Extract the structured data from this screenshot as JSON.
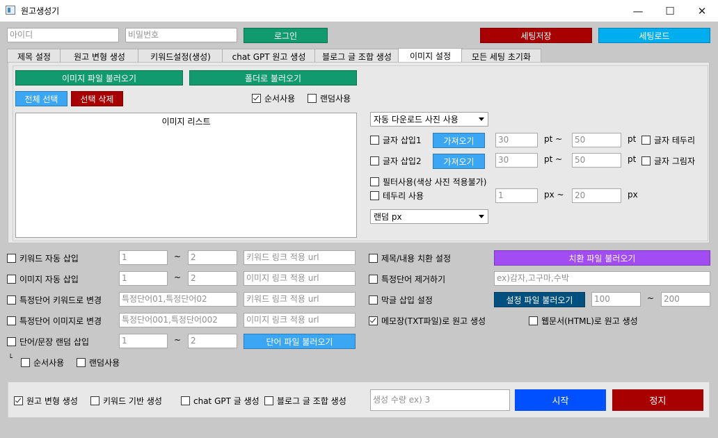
{
  "window": {
    "title": "원고생성기",
    "minimize": "—",
    "maximize": "☐",
    "close": "✕"
  },
  "login": {
    "id_placeholder": "아이디",
    "pw_placeholder": "비밀번호",
    "login_button": "로그인",
    "save_settings": "세팅저장",
    "load_settings": "세팅로드"
  },
  "tabs": [
    "제목 설정",
    "원고 변형 생성",
    "키워드설정(생성)",
    "chat GPT 원고 생성",
    "블로그 글 조합 생성",
    "이미지 설정",
    "모든 세팅 초기화"
  ],
  "image_tab": {
    "load_image_file": "이미지 파일 불러오기",
    "load_folder": "폴더로 불러오기",
    "select_all": "전체 선택",
    "delete_selected": "선택 삭제",
    "order_use": "순서사용",
    "random_use": "랜덤사용",
    "list_header": "이미지 리스트",
    "download_select": "자동 다운로드 사진 사용",
    "text_insert1": "글자 삽입1",
    "text_insert2": "글자 삽입2",
    "fetch": "가져오기",
    "pt_min1": "30",
    "pt_max1": "50",
    "pt_min2": "30",
    "pt_max2": "50",
    "pt_tilde": "pt ~",
    "pt": "pt",
    "text_border": "글자 테두리",
    "text_shadow": "글자 그림자",
    "filter_use": "필터사용(색상 사진 적용불가)",
    "border_use": "테두리 사용",
    "px_min": "1",
    "px_max": "20",
    "px_tilde": "px ~",
    "px": "px",
    "random_px": "랜덤 px"
  },
  "options": {
    "keyword_auto_insert": "키워드 자동 삽입",
    "image_auto_insert": "이미지 자동 삽입",
    "word_to_keyword": "특정단어 키워드로 변경",
    "word_to_image": "특정단어 이미지로 변경",
    "random_sentence_insert": "단어/문장 랜덤 삽입",
    "min1": "1",
    "max1": "2",
    "min2": "1",
    "max2": "2",
    "min3": "1",
    "max3": "2",
    "tilde": "~",
    "keyword_url_placeholder": "키워드 링크 적용 url",
    "image_url_placeholder": "이미지 링크 적용 url",
    "word_keyword_placeholder": "특정단어01,특정단어02",
    "word_image_placeholder": "특정단어001,특정단어002",
    "load_word_file": "단어 파일 불러오기",
    "corner": "└",
    "order_use": "순서사용",
    "random_use": "랜덤사용",
    "title_content_replace": "제목/내용 치환 설정",
    "load_replace_file": "치환 파일 불러오기",
    "remove_word": "특정단어 제거하기",
    "remove_word_placeholder": "ex)감자,고구마,수박",
    "last_insert": "막글 삽입 설정",
    "load_setting_file": "설정 파일 불러오기",
    "last_min": "100",
    "last_max": "200",
    "txt_output": "메모장(TXT파일)로 원고 생성",
    "html_output": "웹문서(HTML)로 원고 생성"
  },
  "bottom": {
    "modify_gen": "원고 변형 생성",
    "keyword_gen": "키워드 기반 생성",
    "gpt_gen": "chat GPT 글 생성",
    "blog_gen": "블로그 글 조합 생성",
    "count_placeholder": "생성 수량 ex) 3",
    "start": "시작",
    "stop": "정지"
  }
}
